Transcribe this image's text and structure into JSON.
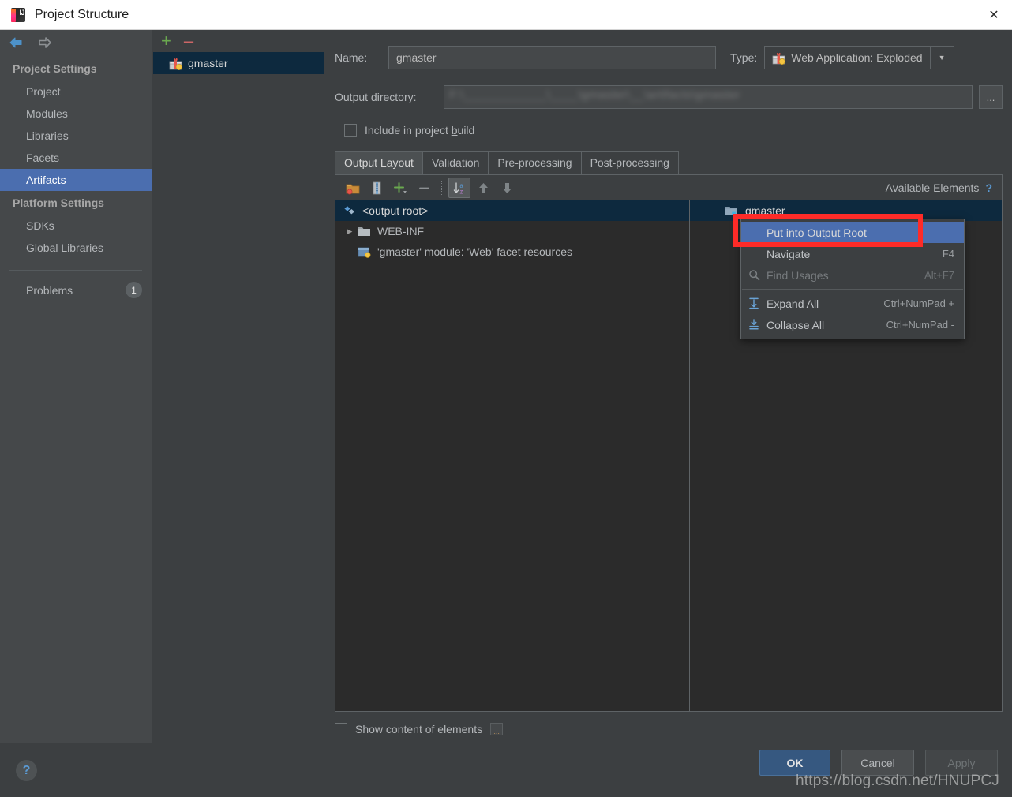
{
  "window": {
    "title": "Project Structure",
    "close_label": "✕",
    "icon": "intellij-idea-logo",
    "logo_text": "IJ"
  },
  "nav": {
    "back_icon": "arrow-left-icon",
    "forward_icon": "arrow-right-icon"
  },
  "sidebar": {
    "groups": [
      {
        "label": "Project Settings",
        "items": [
          {
            "label": "Project",
            "selected": false
          },
          {
            "label": "Modules",
            "selected": false
          },
          {
            "label": "Libraries",
            "selected": false
          },
          {
            "label": "Facets",
            "selected": false
          },
          {
            "label": "Artifacts",
            "selected": true
          }
        ]
      },
      {
        "label": "Platform Settings",
        "items": [
          {
            "label": "SDKs",
            "selected": false
          },
          {
            "label": "Global Libraries",
            "selected": false
          }
        ]
      }
    ],
    "problems": {
      "label": "Problems",
      "count": "1"
    }
  },
  "artifacts_panel": {
    "add_label": "+",
    "remove_label": "–",
    "items": [
      {
        "label": "gmaster",
        "icon": "artifact-gift-icon",
        "selected": true
      }
    ]
  },
  "main": {
    "name_label": "Name:",
    "name_value": "gmaster",
    "type_label": "Type:",
    "type_value": "Web Application: Exploded",
    "type_icon": "artifact-gift-icon",
    "output_label": "Output directory:",
    "output_value": "F:\\____________\\____\\gmaster\\__\\artifacts\\gmaster",
    "browse_label": "...",
    "include_checkbox": {
      "label_before": "Include in project ",
      "label_accel": "b",
      "label_after": "uild",
      "checked": false
    },
    "tabs": [
      {
        "label": "Output Layout",
        "active": true
      },
      {
        "label": "Validation",
        "active": false
      },
      {
        "label": "Pre-processing",
        "active": false
      },
      {
        "label": "Post-processing",
        "active": false
      }
    ],
    "toolbar": [
      {
        "name": "create-directory-icon",
        "pressed": false
      },
      {
        "name": "create-archive-icon",
        "pressed": false
      },
      {
        "name": "add-copy-of-icon",
        "pressed": false
      },
      {
        "name": "remove-icon",
        "pressed": false
      },
      {
        "name": "sort-alphabetically-icon",
        "pressed": true
      },
      {
        "name": "move-up-icon",
        "pressed": false
      },
      {
        "name": "move-down-icon",
        "pressed": false
      }
    ],
    "available_elements_label": "Available Elements",
    "available_help_label": "?",
    "output_tree": [
      {
        "label": "<output root>",
        "icon": "output-root-icon",
        "indent": 0,
        "selected": true,
        "expandable": false
      },
      {
        "label": "WEB-INF",
        "icon": "folder-icon",
        "indent": 1,
        "selected": false,
        "expandable": true
      },
      {
        "label": "'gmaster' module: 'Web' facet resources",
        "icon": "web-facet-icon",
        "indent": 1,
        "selected": false,
        "expandable": false
      }
    ],
    "available_tree": [
      {
        "label": "gmaster",
        "icon": "module-icon",
        "selected": true
      }
    ],
    "show_content_label": "Show content of elements",
    "show_content_checked": false,
    "show_content_dots": "..."
  },
  "context_menu": {
    "items": [
      {
        "label": "Put into Output Root",
        "accel": "",
        "icon": "",
        "highlight": true,
        "disabled": false
      },
      {
        "label": "Navigate",
        "accel": "F4",
        "icon": "",
        "highlight": false,
        "disabled": false
      },
      {
        "label": "Find Usages",
        "accel": "Alt+F7",
        "icon": "search-icon",
        "highlight": false,
        "disabled": true
      },
      {
        "separator": true
      },
      {
        "label": "Expand All",
        "accel": "Ctrl+NumPad +",
        "icon": "expand-all-icon",
        "highlight": false,
        "disabled": false
      },
      {
        "label": "Collapse All",
        "accel": "Ctrl+NumPad -",
        "icon": "collapse-all-icon",
        "highlight": false,
        "disabled": false
      }
    ]
  },
  "footer": {
    "help_label": "?",
    "ok_label": "OK",
    "cancel_label": "Cancel",
    "apply_label": "Apply",
    "watermark": "https://blog.csdn.net/HNUPCJ"
  },
  "colors": {
    "accent_blue": "#4b6eaf",
    "selection_navy": "#0d293e",
    "annotation_red": "#fe2b28",
    "ok_button": "#365880",
    "add_green": "#6aa84f",
    "remove_red": "#cc6666"
  }
}
